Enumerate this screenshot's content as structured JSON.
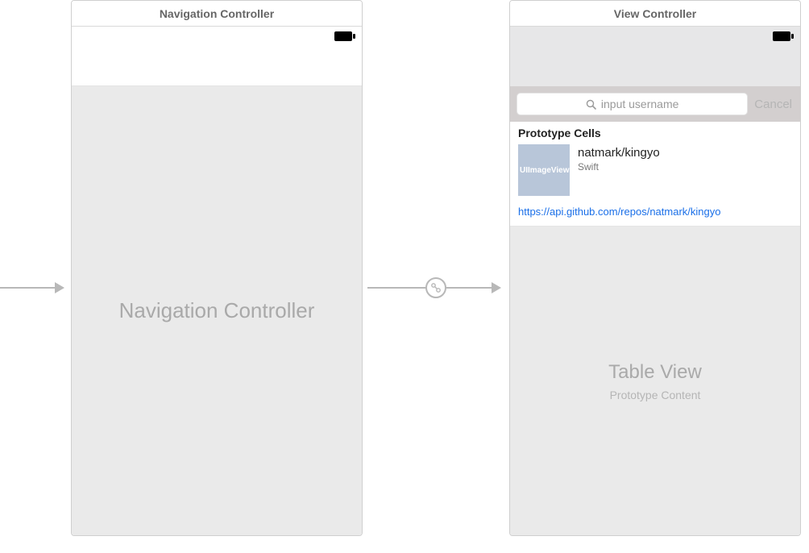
{
  "left_scene": {
    "title": "Navigation Controller",
    "body_label": "Navigation Controller"
  },
  "right_scene": {
    "title": "View Controller",
    "search": {
      "placeholder": "input username",
      "cancel_label": "Cancel"
    },
    "prototype": {
      "header": "Prototype Cells",
      "thumb_label": "UIImageView",
      "cell_title": "natmark/kingyo",
      "cell_subtitle": "Swift",
      "url": "https://api.github.com/repos/natmark/kingyo"
    },
    "table_view": {
      "big": "Table View",
      "small": "Prototype Content"
    }
  }
}
